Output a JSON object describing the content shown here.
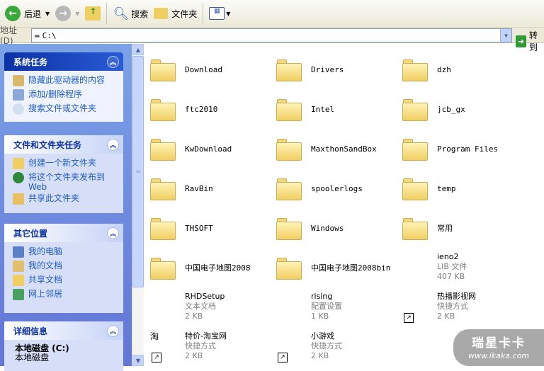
{
  "toolbar": {
    "back": "后退",
    "search": "搜索",
    "folders": "文件夹"
  },
  "address": {
    "label": "地址 (D)",
    "value": "C:\\",
    "go": "转到"
  },
  "panels": [
    {
      "title": "系统任务",
      "items": [
        "隐藏此驱动器的内容",
        "添加/删除程序",
        "搜索文件或文件夹"
      ]
    },
    {
      "title": "文件和文件夹任务",
      "items": [
        "创建一个新文件夹",
        "将这个文件夹发布到 Web",
        "共享此文件夹"
      ]
    },
    {
      "title": "其它位置",
      "items": [
        "我的电脑",
        "我的文档",
        "共享文档",
        "网上邻居"
      ]
    },
    {
      "title": "详细信息",
      "name": "本地磁盘 (C:)",
      "type": "本地磁盘"
    }
  ],
  "folders": [
    "Download",
    "Drivers",
    "dzh",
    "ftc2010",
    "Intel",
    "jcb_gx",
    "KwDownload",
    "MaxthonSandBox",
    "Program Files",
    "RavBin",
    "spoolerlogs",
    "temp",
    "THSOFT",
    "Windows",
    "常用",
    "中国电子地图2008",
    "中国电子地图2008bin"
  ],
  "files": [
    {
      "name": "ieno2",
      "type": "LIB 文件",
      "size": "407 KB"
    },
    {
      "name": "RHDSetup",
      "type": "文本文档",
      "size": "2 KB"
    },
    {
      "name": "rising",
      "type": "配置设置",
      "size": "1 KB"
    },
    {
      "name": "热播影视网",
      "type": "快捷方式",
      "size": "2 KB"
    },
    {
      "name": "特价-淘宝网",
      "type": "快捷方式",
      "size": "2 KB"
    },
    {
      "name": "小游戏",
      "type": "快捷方式",
      "size": "2 KB"
    }
  ],
  "watermark": {
    "title": "瑞星卡卡",
    "url": "www.ikaka.com"
  }
}
